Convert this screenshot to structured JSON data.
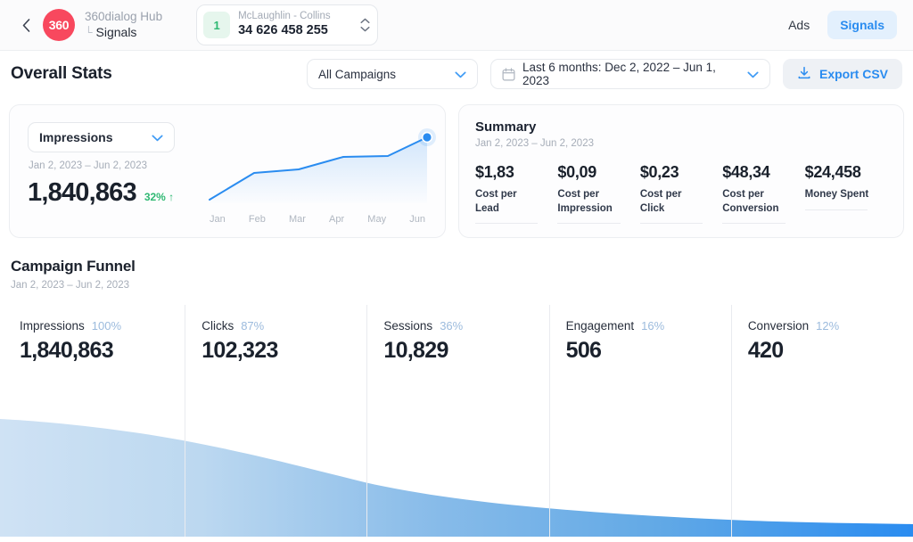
{
  "topbar": {
    "back_icon": "chevron-left-icon",
    "logo_text": "360",
    "brand_title": "360dialog Hub",
    "brand_corner": "└",
    "brand_sub": "Signals",
    "account": {
      "badge": "1",
      "name": "McLaughlin - Collins",
      "number": "34 626 458 255"
    },
    "nav": [
      {
        "label": "Ads",
        "active": false
      },
      {
        "label": "Signals",
        "active": true
      }
    ]
  },
  "filterbar": {
    "page_title": "Overall Stats",
    "campaign_select": "All Campaigns",
    "date_range": "Last 6 months: Dec 2, 2022 – Jun 1, 2023",
    "export_label": "Export CSV",
    "calendar_icon": "calendar-icon",
    "download_icon": "download-icon",
    "chevron_icon": "chevron-down-icon"
  },
  "impressions_card": {
    "metric": "Impressions",
    "date_range": "Jan 2, 2023 – Jun 2, 2023",
    "value": "1,840,863",
    "delta": "32% ↑"
  },
  "summary": {
    "title": "Summary",
    "date_range": "Jan 2, 2023 – Jun 2, 2023",
    "cells": [
      {
        "value": "$1,83",
        "label": "Cost per Lead"
      },
      {
        "value": "$0,09",
        "label": "Cost per Impression"
      },
      {
        "value": "$0,23",
        "label": "Cost per Click"
      },
      {
        "value": "$48,34",
        "label": "Cost per Conversion"
      },
      {
        "value": "$24,458",
        "label": "Money Spent"
      }
    ]
  },
  "funnel": {
    "title": "Campaign Funnel",
    "date_range": "Jan 2, 2023 – Jun 2, 2023",
    "stages": [
      {
        "name": "Impressions",
        "pct": "100%",
        "value": "1,840,863"
      },
      {
        "name": "Clicks",
        "pct": "87%",
        "value": "102,323"
      },
      {
        "name": "Sessions",
        "pct": "36%",
        "value": "10,829"
      },
      {
        "name": "Engagement",
        "pct": "16%",
        "value": "506"
      },
      {
        "name": "Conversion",
        "pct": "12%",
        "value": "420"
      }
    ]
  },
  "colors": {
    "accent_blue": "#2a8cf0",
    "brand_red": "#f8485e",
    "green": "#2eb872",
    "funnel_light": "#c3dcf2",
    "funnel_dark": "#2a8cf0"
  },
  "chart_data": [
    {
      "type": "line",
      "title": "Impressions",
      "x": [
        "Jan",
        "Feb",
        "Mar",
        "Apr",
        "May",
        "Jun"
      ],
      "values": [
        12,
        44,
        48,
        62,
        63,
        92
      ],
      "ylim": [
        0,
        100
      ],
      "grid": false,
      "legend": "none",
      "last_point_marker": true
    },
    {
      "type": "area",
      "title": "Campaign Funnel",
      "categories": [
        "Impressions",
        "Clicks",
        "Sessions",
        "Engagement",
        "Conversion"
      ],
      "pct": [
        100,
        87,
        36,
        16,
        12
      ],
      "values": [
        1840863,
        102323,
        10829,
        506,
        420
      ],
      "ylim": [
        0,
        100
      ],
      "grid": false,
      "legend": "none"
    }
  ]
}
